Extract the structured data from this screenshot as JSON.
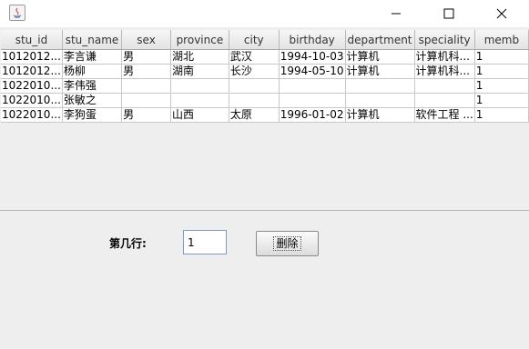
{
  "window": {
    "minimize_symbol": "—",
    "maximize_symbol": "☐",
    "close_symbol": "✕"
  },
  "table": {
    "columns": [
      "stu_id",
      "stu_name",
      "sex",
      "province",
      "city",
      "birthday",
      "department",
      "speciality",
      "memb"
    ],
    "rows": [
      [
        "1012012...",
        "李言谦",
        "男",
        "湖北",
        "武汉",
        "1994-10-03",
        "计算机",
        "计算机科...",
        "1"
      ],
      [
        "1012012...",
        "杨柳",
        "男",
        "湖南",
        "长沙",
        "1994-05-10",
        "计算机",
        "计算机科...",
        "1"
      ],
      [
        "1022010...",
        "李伟强",
        "",
        "",
        "",
        "",
        "",
        "",
        "1"
      ],
      [
        "1022010...",
        "张敏之",
        "",
        "",
        "",
        "",
        "",
        "",
        "1"
      ],
      [
        "1022010...",
        "李狗蛋",
        "男",
        "山西",
        "太原",
        "1996-01-02",
        "计算机",
        "软件工程 ...",
        "1"
      ]
    ]
  },
  "form": {
    "row_label": "第几行:",
    "row_value": "1",
    "delete_label": "删除"
  }
}
